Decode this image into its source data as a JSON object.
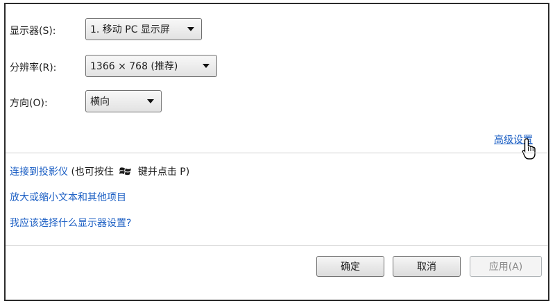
{
  "display": {
    "label": "显示器(S):",
    "value": "1. 移动 PC 显示屏"
  },
  "resolution": {
    "label": "分辨率(R):",
    "value": "1366 × 768 (推荐)"
  },
  "orientation": {
    "label": "方向(O):",
    "value": "横向"
  },
  "advanced_link": "高级设置",
  "projector": {
    "link": "连接到投影仪",
    "hint_prefix": " (也可按住 ",
    "hint_suffix": " 键并点击 P)"
  },
  "zoom_link": "放大或缩小文本和其他项目",
  "help_link": "我应该选择什么显示器设置?",
  "buttons": {
    "ok": "确定",
    "cancel": "取消",
    "apply": "应用(A)"
  }
}
